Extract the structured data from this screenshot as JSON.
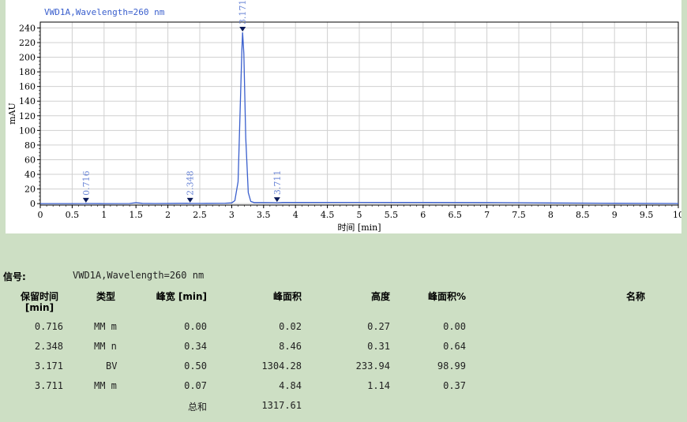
{
  "signal_title": "VWD1A,Wavelength=260 nm",
  "colors": {
    "trace": "#3a5fcd",
    "background": "#cddfc4",
    "grid": "#d0d0d0"
  },
  "chart_data": {
    "type": "line",
    "xlabel": "时间 [min]",
    "ylabel": "mAU",
    "xlim": [
      0,
      10
    ],
    "ylim": [
      -2,
      248
    ],
    "x_ticks": [
      "0",
      "0.5",
      "1",
      "1.5",
      "2",
      "2.5",
      "3",
      "3.5",
      "4",
      "4.5",
      "5",
      "5.5",
      "6",
      "6.5",
      "7",
      "7.5",
      "8",
      "8.5",
      "9",
      "9.5",
      "10"
    ],
    "y_ticks": [
      "0",
      "20",
      "40",
      "60",
      "80",
      "100",
      "120",
      "140",
      "160",
      "180",
      "200",
      "220",
      "240"
    ],
    "grid": true,
    "series": [
      {
        "x": [
          0,
          0.5,
          0.7,
          0.716,
          0.74,
          1.0,
          1.4,
          1.5,
          1.6,
          1.8,
          2.1,
          2.3,
          2.348,
          2.4,
          2.6,
          2.9,
          3.0,
          3.05,
          3.1,
          3.13,
          3.16,
          3.171,
          3.19,
          3.22,
          3.26,
          3.3,
          3.35,
          3.5,
          3.65,
          3.7,
          3.711,
          3.73,
          3.8,
          4.0,
          5.0,
          6.0,
          7.0,
          7.5,
          8.0,
          9.0,
          10.0
        ],
        "y": [
          0,
          0.1,
          0.2,
          0.27,
          0.2,
          0.1,
          0.2,
          1.3,
          0.4,
          0.2,
          0.4,
          0.6,
          0.31,
          0.3,
          0.4,
          0.6,
          1.0,
          4.0,
          30.0,
          120.0,
          210.0,
          233.94,
          205.0,
          90.0,
          15.0,
          3.0,
          1.5,
          1.4,
          1.3,
          1.2,
          1.14,
          1.2,
          1.6,
          1.6,
          1.7,
          1.6,
          1.5,
          1.2,
          0.9,
          0.5,
          0.2
        ]
      }
    ],
    "peaks": [
      {
        "rt": 0.716,
        "label": "0.716",
        "height": 0.27
      },
      {
        "rt": 2.348,
        "label": "2.348",
        "height": 0.31
      },
      {
        "rt": 3.171,
        "label": "3.171",
        "height": 233.94
      },
      {
        "rt": 3.711,
        "label": "3.711",
        "height": 1.14
      }
    ]
  },
  "table": {
    "signal_label": "信号:",
    "signal_value": "VWD1A,Wavelength=260 nm",
    "headers": {
      "rt": "保留时间",
      "rt_unit": "[min]",
      "type": "类型",
      "width": "峰宽 [min]",
      "area": "峰面积",
      "height": "高度",
      "area_pct": "峰面积%",
      "name": "名称"
    },
    "rows": [
      {
        "rt": "0.716",
        "type": "MM m",
        "width": "0.00",
        "area": "0.02",
        "height": "0.27",
        "area_pct": "0.00"
      },
      {
        "rt": "2.348",
        "type": "MM n",
        "width": "0.34",
        "area": "8.46",
        "height": "0.31",
        "area_pct": "0.64"
      },
      {
        "rt": "3.171",
        "type": "BV",
        "width": "0.50",
        "area": "1304.28",
        "height": "233.94",
        "area_pct": "98.99"
      },
      {
        "rt": "3.711",
        "type": "MM m",
        "width": "0.07",
        "area": "4.84",
        "height": "1.14",
        "area_pct": "0.37"
      }
    ],
    "total_label": "总和",
    "total_area": "1317.61"
  }
}
